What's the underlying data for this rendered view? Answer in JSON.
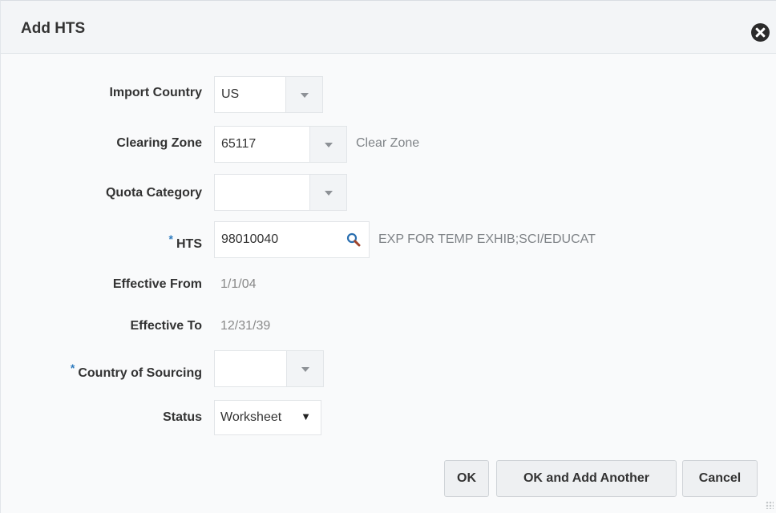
{
  "dialog": {
    "title": "Add HTS",
    "close_icon": "close-circle-icon"
  },
  "fields": {
    "import_country": {
      "label": "Import Country",
      "value": "US"
    },
    "clearing_zone": {
      "label": "Clearing Zone",
      "value": "65117",
      "description": "Clear Zone"
    },
    "quota_category": {
      "label": "Quota Category",
      "value": ""
    },
    "hts": {
      "required_mark": "*",
      "label": "HTS",
      "value": "98010040",
      "description": "EXP FOR TEMP EXHIB;SCI/EDUCAT",
      "icon": "search-icon"
    },
    "effective_from": {
      "label": "Effective From",
      "value": "1/1/04"
    },
    "effective_to": {
      "label": "Effective To",
      "value": "12/31/39"
    },
    "country_of_sourcing": {
      "required_mark": "*",
      "label": "Country of Sourcing",
      "value": ""
    },
    "status": {
      "label": "Status",
      "value": "Worksheet",
      "arrow": "▼"
    }
  },
  "buttons": {
    "ok": "OK",
    "ok_add_another": "OK and Add Another",
    "cancel": "Cancel"
  },
  "colors": {
    "required": "#2f7cbf",
    "muted_text": "#7f8387",
    "search_icon": "#2a6fb0"
  }
}
